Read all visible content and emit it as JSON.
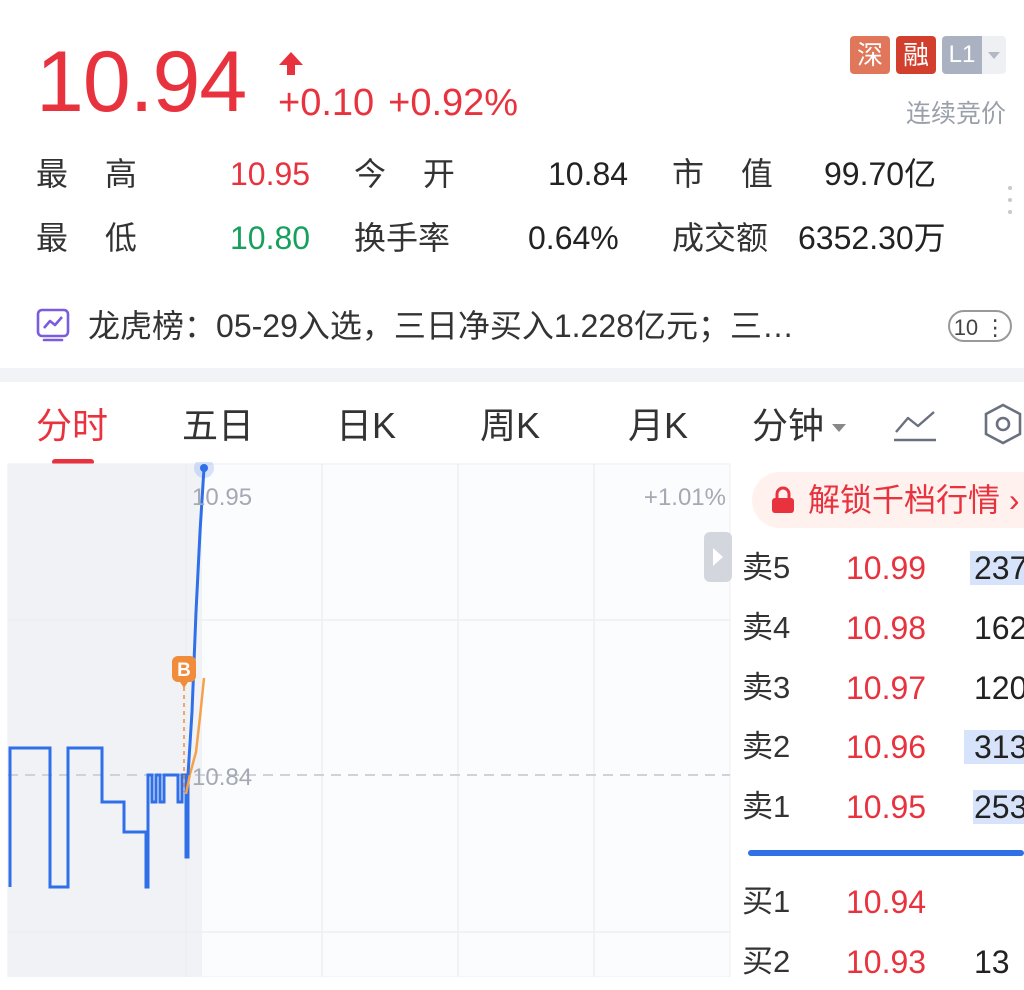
{
  "quote": {
    "price": "10.94",
    "change": "+0.10",
    "change_pct": "+0.92%",
    "tags": {
      "exchange": "深",
      "margin": "融",
      "level": "L1"
    },
    "auction_label": "连续竞价",
    "colors": {
      "up": "#e8333f",
      "down": "#17a05d",
      "accent": "#2f6fe8"
    }
  },
  "stats": {
    "high_label": "最 高",
    "high": "10.95",
    "open_label": "今 开",
    "open": "10.84",
    "mktcap_label": "市 值",
    "mktcap": "99.70亿",
    "low_label": "最 低",
    "low": "10.80",
    "turnover_label": "换手率",
    "turnover": "0.64%",
    "amount_label": "成交额",
    "amount": "6352.30万"
  },
  "dragon_tiger": {
    "label": "龙虎榜：",
    "text": "05-29入选，三日净买入1.228亿元；三…",
    "badge": "10"
  },
  "tabs": [
    {
      "label": "分时",
      "active": true
    },
    {
      "label": "五日"
    },
    {
      "label": "日K"
    },
    {
      "label": "周K"
    },
    {
      "label": "月K"
    },
    {
      "label": "分钟"
    }
  ],
  "chart": {
    "high_label": "10.95",
    "mid_label": "10.84",
    "pct_label": "+1.01%",
    "marker": "B"
  },
  "order_book": {
    "unlock_label": "解锁千档行情",
    "asks": [
      {
        "label": "卖5",
        "price": "10.99",
        "volume": "237",
        "bar": 0.9
      },
      {
        "label": "卖4",
        "price": "10.98",
        "volume": "162",
        "bar": 0
      },
      {
        "label": "卖3",
        "price": "10.97",
        "volume": "120",
        "bar": 0
      },
      {
        "label": "卖2",
        "price": "10.96",
        "volume": "313",
        "bar": 1.0
      },
      {
        "label": "卖1",
        "price": "10.95",
        "volume": "253",
        "bar": 0.85
      }
    ],
    "bids": [
      {
        "label": "买1",
        "price": "10.94",
        "volume": ""
      },
      {
        "label": "买2",
        "price": "10.93",
        "volume": "13"
      }
    ]
  },
  "icons": {
    "up": "arrow-up-icon",
    "dragon": "trend-chart-icon",
    "line_tool": "line-chart-icon",
    "settings": "hexagon-icon",
    "lock": "lock-icon",
    "collapse": "chevron-right-icon"
  }
}
